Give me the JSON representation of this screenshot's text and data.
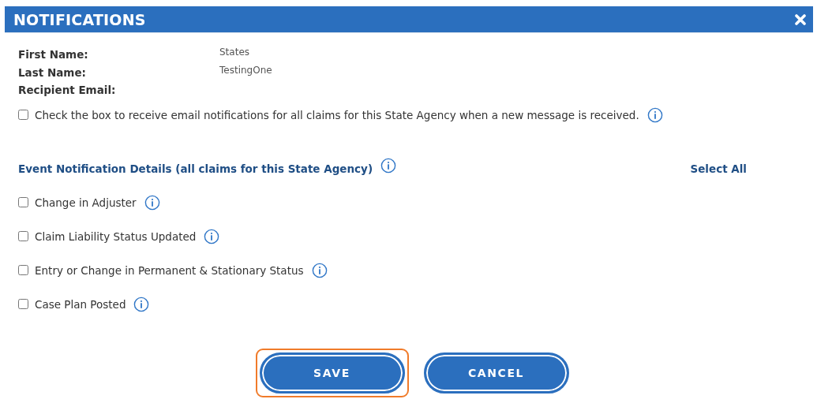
{
  "window": {
    "title": "NOTIFICATIONS"
  },
  "fields": [
    {
      "label": "First Name:",
      "value": "States"
    },
    {
      "label": "Last Name:",
      "value": "TestingOne"
    },
    {
      "label": "Recipient Email:"
    }
  ],
  "email_option": {
    "label": "Check the box to receive email notifications for all claims for this State Agency when a new message is received.",
    "checked": false
  },
  "event_section": {
    "title": "Event Notification Details (all claims for this State Agency)",
    "select_all": "Select All",
    "items": [
      {
        "label": "Change in Adjuster",
        "checked": false
      },
      {
        "label": "Claim Liability Status Updated",
        "checked": false
      },
      {
        "label": "Entry or Change in Permanent & Stationary Status",
        "checked": false
      },
      {
        "label": "Case Plan Posted",
        "checked": false
      }
    ]
  },
  "buttons": [
    {
      "label": "SAVE",
      "focused": true
    },
    {
      "label": "CANCEL",
      "focused": false
    }
  ]
}
